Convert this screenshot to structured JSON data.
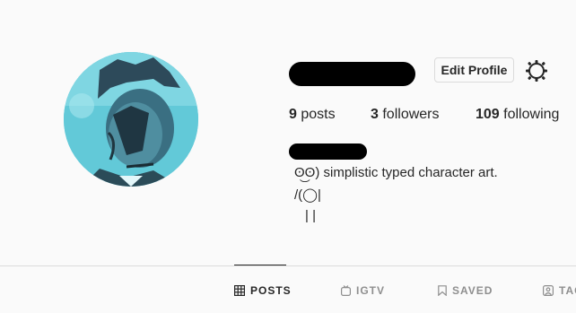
{
  "profile": {
    "avatar_description": "profile-picture",
    "edit_profile_label": "Edit Profile",
    "settings_icon": "gear-icon",
    "stats": {
      "posts_count": "9",
      "posts_label": "posts",
      "followers_count": "3",
      "followers_label": "followers",
      "following_count": "109",
      "following_label": "following"
    },
    "bio": {
      "line1": "ʘ͜ʘ) simplistic typed character art.",
      "line2": "/(◯|",
      "line3": "| |"
    }
  },
  "tabs": [
    {
      "label": "POSTS",
      "icon": "grid-icon",
      "active": true
    },
    {
      "label": "IGTV",
      "icon": "igtv-icon",
      "active": false
    },
    {
      "label": "SAVED",
      "icon": "bookmark-icon",
      "active": false
    },
    {
      "label": "TAG",
      "icon": "tagged-icon",
      "active": false
    }
  ],
  "colors": {
    "text": "#262626",
    "muted": "#8e8e8e",
    "border": "#dbdbdb",
    "avatar_tint": "#5fc6d6"
  }
}
